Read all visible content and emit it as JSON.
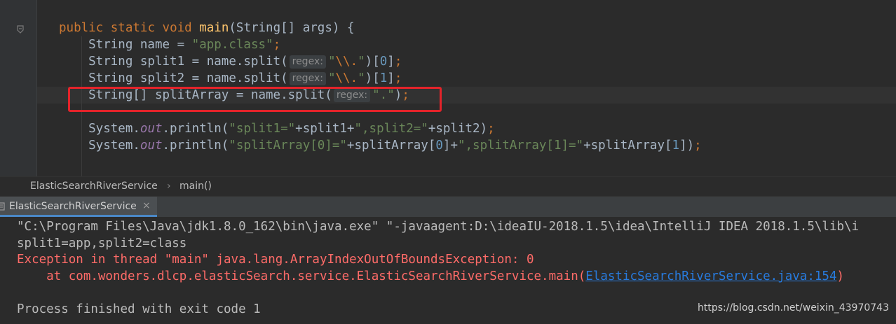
{
  "editor": {
    "code_lines": [
      {
        "segments": [
          {
            "t": "public ",
            "c": "kw"
          },
          {
            "t": "static ",
            "c": "kw"
          },
          {
            "t": "void ",
            "c": "kw"
          },
          {
            "t": "main",
            "c": "fn"
          },
          {
            "t": "(String[] args) {",
            "c": ""
          }
        ]
      },
      {
        "segments": [
          {
            "t": "    String name = ",
            "c": ""
          },
          {
            "t": "\"app.class\"",
            "c": "str"
          },
          {
            "t": ";",
            "c": "kw"
          }
        ]
      },
      {
        "segments": [
          {
            "t": "    String split1 = name.split(",
            "c": ""
          },
          {
            "t": "regex:",
            "c": "hint"
          },
          {
            "t": "\"",
            "c": "str"
          },
          {
            "t": "\\\\.",
            "c": "esc"
          },
          {
            "t": "\"",
            "c": "str"
          },
          {
            "t": ")[",
            "c": ""
          },
          {
            "t": "0",
            "c": "num"
          },
          {
            "t": "]",
            "c": ""
          },
          {
            "t": ";",
            "c": "kw"
          }
        ]
      },
      {
        "segments": [
          {
            "t": "    String split2 = name.split(",
            "c": ""
          },
          {
            "t": "regex:",
            "c": "hint"
          },
          {
            "t": "\"",
            "c": "str"
          },
          {
            "t": "\\\\.",
            "c": "esc"
          },
          {
            "t": "\"",
            "c": "str"
          },
          {
            "t": ")[",
            "c": ""
          },
          {
            "t": "1",
            "c": "num"
          },
          {
            "t": "]",
            "c": ""
          },
          {
            "t": ";",
            "c": "kw"
          }
        ]
      },
      {
        "segments": [
          {
            "t": "    String[] splitArray = name.split(",
            "c": ""
          },
          {
            "t": "regex:",
            "c": "hint"
          },
          {
            "t": "\".\"",
            "c": "str"
          },
          {
            "t": ")",
            "c": ""
          },
          {
            "t": ";",
            "c": "kw"
          }
        ]
      },
      {
        "segments": []
      },
      {
        "segments": [
          {
            "t": "    System.",
            "c": ""
          },
          {
            "t": "out",
            "c": "fld"
          },
          {
            "t": ".println(",
            "c": ""
          },
          {
            "t": "\"split1=\"",
            "c": "str"
          },
          {
            "t": "+split1+",
            "c": ""
          },
          {
            "t": "\",split2=\"",
            "c": "str"
          },
          {
            "t": "+split2)",
            "c": ""
          },
          {
            "t": ";",
            "c": "kw"
          }
        ]
      },
      {
        "segments": [
          {
            "t": "    System.",
            "c": ""
          },
          {
            "t": "out",
            "c": "fld"
          },
          {
            "t": ".println(",
            "c": ""
          },
          {
            "t": "\"splitArray[0]=\"",
            "c": "str"
          },
          {
            "t": "+splitArray[",
            "c": ""
          },
          {
            "t": "0",
            "c": "num"
          },
          {
            "t": "]+",
            "c": ""
          },
          {
            "t": "\",splitArray[1]=\"",
            "c": "str"
          },
          {
            "t": "+splitArray[",
            "c": ""
          },
          {
            "t": "1",
            "c": "num"
          },
          {
            "t": "])",
            "c": ""
          },
          {
            "t": ";",
            "c": "kw"
          }
        ]
      }
    ]
  },
  "breadcrumb": {
    "class_name": "ElasticSearchRiverService",
    "separator": "›",
    "method_name": "main()"
  },
  "run": {
    "tab_label": "ElasticSearchRiverService",
    "close_glyph": "×",
    "console": {
      "command": "\"C:\\Program Files\\Java\\jdk1.8.0_162\\bin\\java.exe\" \"-javaagent:D:\\ideaIU-2018.1.5\\idea\\IntelliJ IDEA 2018.1.5\\lib\\i",
      "output": "split1=app,split2=class",
      "exception": "Exception in thread \"main\" java.lang.ArrayIndexOutOfBoundsException: 0",
      "stack_prefix": "    at com.wonders.dlcp.elasticSearch.service.ElasticSearchRiverService.main(",
      "stack_link": "ElasticSearchRiverService.java:154",
      "stack_suffix": ")",
      "exit": "Process finished with exit code 1"
    }
  },
  "watermark": "https://blog.csdn.net/weixin_43970743",
  "colors": {
    "background": "#2b2b2b",
    "keyword": "#cc7832",
    "string": "#6a8759",
    "error": "#ff6b68",
    "link": "#287bde",
    "highlight_box": "#e4232a"
  }
}
